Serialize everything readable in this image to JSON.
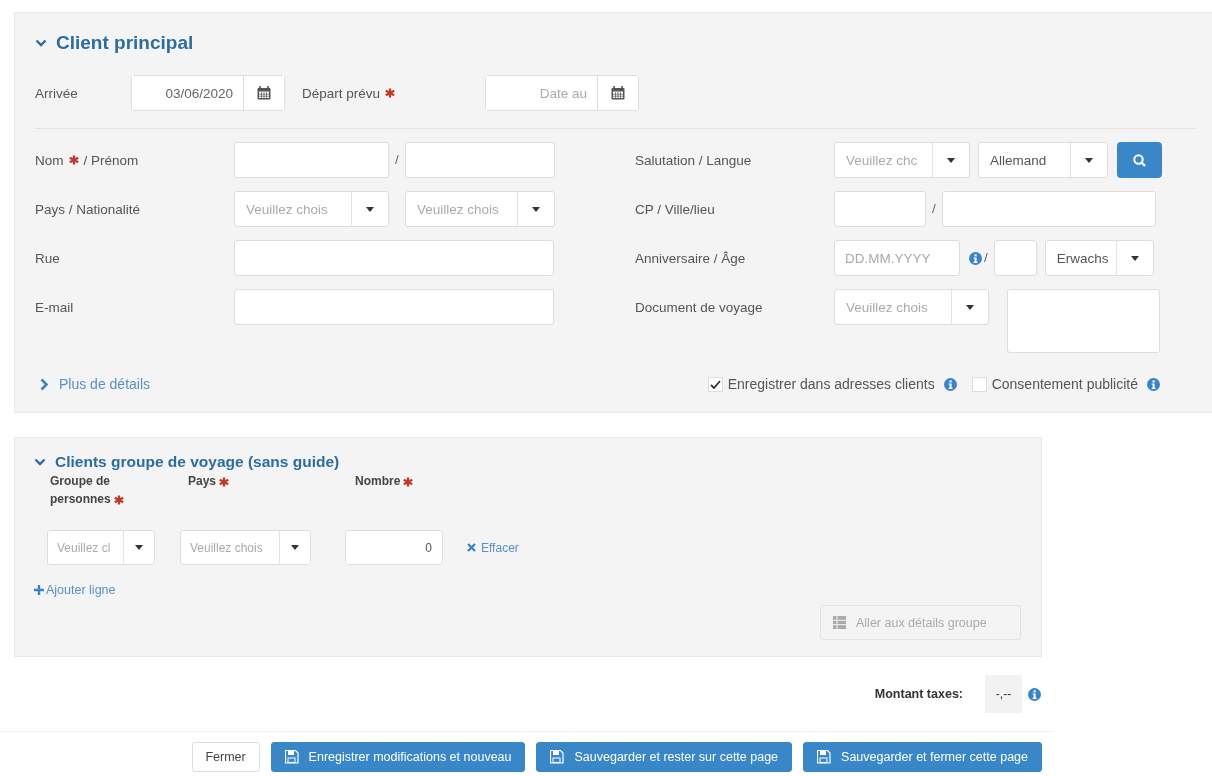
{
  "main_client": {
    "title": "Client principal",
    "expanded": true,
    "arrival": {
      "label": "Arrivée",
      "value": "03/06/2020"
    },
    "departure": {
      "label": "Départ prévu",
      "required": true,
      "placeholder": "Date au"
    },
    "left_rows": [
      {
        "label": "Nom",
        "required": true,
        "label_rest": "/ Prénom",
        "fields": [
          {
            "kind": "text"
          },
          {
            "kind": "sep",
            "text": "/"
          },
          {
            "kind": "text"
          }
        ]
      },
      {
        "label": "Pays / Nationalité",
        "required": false,
        "fields": [
          {
            "kind": "select",
            "placeholder": "Veuillez chois"
          },
          {
            "kind": "select",
            "placeholder": "Veuillez chois"
          }
        ]
      },
      {
        "label": "Rue",
        "required": false,
        "fields": [
          {
            "kind": "text"
          }
        ]
      },
      {
        "label": "E-mail",
        "required": false,
        "fields": [
          {
            "kind": "text"
          }
        ]
      }
    ],
    "right_rows": [
      {
        "label": "Salutation / Langue",
        "required": false,
        "fields": [
          {
            "kind": "select",
            "placeholder": "Veuillez chc"
          },
          {
            "kind": "select",
            "value": "Allemand"
          },
          {
            "kind": "search"
          }
        ]
      },
      {
        "label": "CP / Ville/lieu",
        "required": false,
        "fields": [
          {
            "kind": "text"
          },
          {
            "kind": "sep",
            "text": "/"
          },
          {
            "kind": "text"
          }
        ]
      },
      {
        "label": "Anniversaire / Âge",
        "required": false,
        "fields": [
          {
            "kind": "text",
            "placeholder": "DD.MM.YYYY"
          },
          {
            "kind": "info"
          },
          {
            "kind": "sep",
            "text": "/"
          },
          {
            "kind": "text"
          },
          {
            "kind": "select",
            "value": "Erwachs"
          }
        ]
      },
      {
        "label": "Document de voyage",
        "required": false,
        "fields": [
          {
            "kind": "select",
            "placeholder": "Veuillez chois"
          },
          {
            "kind": "textarea"
          }
        ]
      }
    ],
    "more_link": {
      "label": "Plus de détails",
      "expanded": false
    },
    "checkboxes": [
      {
        "label": "Enregistrer dans adresses clients",
        "checked": true,
        "info": true
      },
      {
        "label": "Consentement publicité",
        "checked": false,
        "info": true
      }
    ]
  },
  "travel_group": {
    "title": "Clients groupe de voyage (sans guide)",
    "expanded": true,
    "columns": [
      {
        "label": "Groupe de personnes",
        "required": true
      },
      {
        "label": "Pays",
        "required": true
      },
      {
        "label": "Nombre",
        "required": true
      }
    ],
    "rows": [
      {
        "group_placeholder": "Veuillez cl",
        "country_placeholder": "Veuillez chois",
        "count": "0",
        "delete_label": "Effacer"
      }
    ],
    "add_label": "Ajouter ligne",
    "details_button": {
      "label": "Aller aux détails groupe",
      "disabled": true
    }
  },
  "taxes": {
    "label": "Montant taxes:",
    "value": "-,--"
  },
  "buttons": [
    {
      "label": "Fermer",
      "kind": "default"
    },
    {
      "label": "Enregistrer modifications et nouveau",
      "kind": "save"
    },
    {
      "label": "Sauvegarder et rester sur cette page",
      "kind": "save"
    },
    {
      "label": "Sauvegarder et fermer cette page",
      "kind": "save"
    }
  ]
}
